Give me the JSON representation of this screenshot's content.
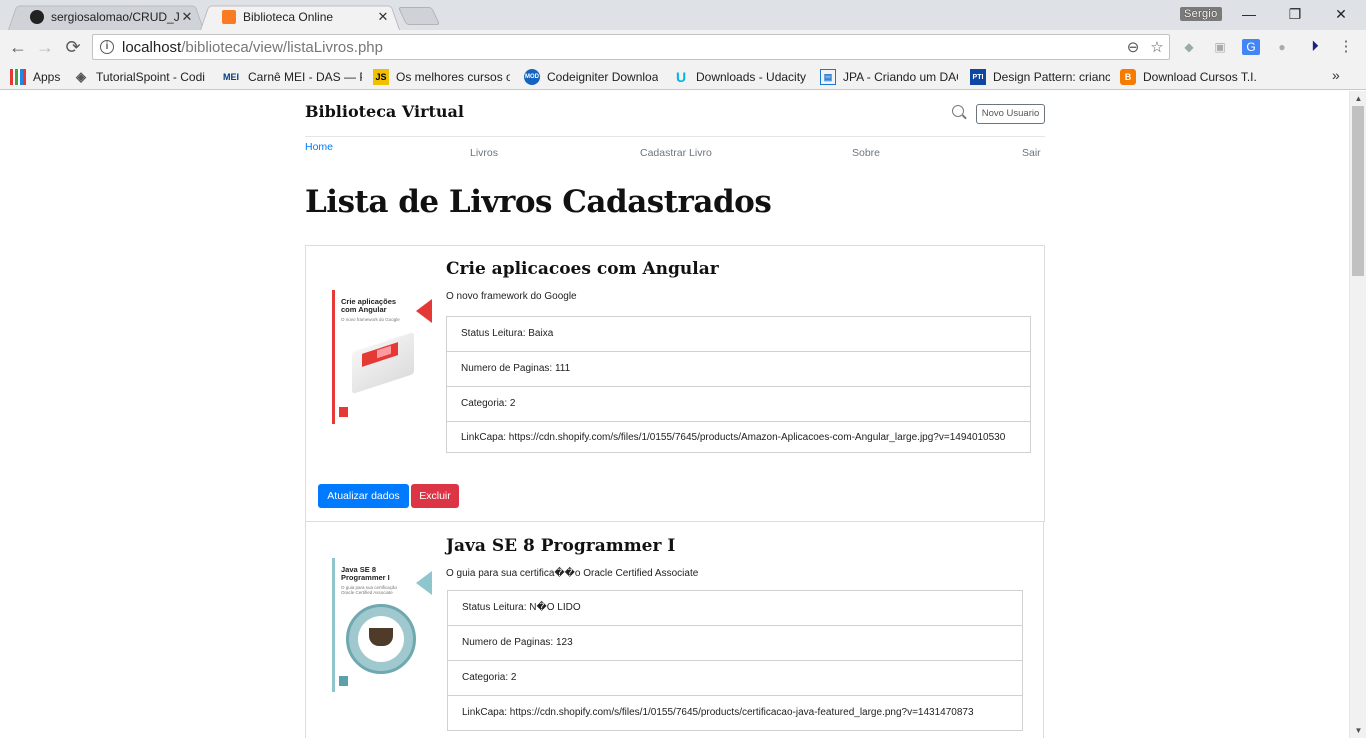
{
  "browser": {
    "tabs": [
      {
        "title": "sergiosalomao/CRUD_JSP",
        "active": false
      },
      {
        "title": "Biblioteca Online",
        "active": true
      }
    ],
    "profile_name": "Sergio",
    "address": {
      "host": "localhost",
      "path": "/biblioteca/view/listaLivros.php"
    },
    "bookmarks": [
      {
        "label": "Apps",
        "icon": "apps-grid-icon",
        "color": "#e44"
      },
      {
        "label": "TutorialSpoint - Codi",
        "icon": "tutorialspoint-icon",
        "color": "#555"
      },
      {
        "label": "Carnê MEI - DAS — P",
        "icon": "mei-icon",
        "color": "#0a3c7a"
      },
      {
        "label": "Os melhores cursos o",
        "icon": "js-icon",
        "color": "#f0c000"
      },
      {
        "label": "Codeigniter Downloa",
        "icon": "codeigniter-icon",
        "color": "#1565c0"
      },
      {
        "label": "Downloads - Udacity",
        "icon": "udacity-icon",
        "color": "#02b3e4"
      },
      {
        "label": "JPA - Criando um DAO",
        "icon": "page-icon",
        "color": "#1976d2"
      },
      {
        "label": "Design Pattern: crianc",
        "icon": "pti-icon",
        "color": "#0d47a1"
      },
      {
        "label": "Download Cursos T.I.",
        "icon": "blogger-icon",
        "color": "#f57c00"
      }
    ],
    "more_bookmarks": "»"
  },
  "site": {
    "brand": "Biblioteca Virtual",
    "new_user_label": "Novo Usuario",
    "nav": {
      "home": "Home",
      "books": "Livros",
      "register": "Cadastrar Livro",
      "about": "Sobre",
      "logout": "Sair"
    },
    "heading": "Lista de Livros Cadastrados"
  },
  "books": [
    {
      "title": "Crie aplicacoes com Angular",
      "subtitle": "O novo framework do Google",
      "status": "Status Leitura: Baixa",
      "pages": "Numero de Paginas: 111",
      "category": "Categoria: 2",
      "cover_link": "LinkCapa: https://cdn.shopify.com/s/files/1/0155/7645/products/Amazon-Aplicacoes-com-Angular_large.jpg?v=1494010530",
      "cover": {
        "title": "Crie aplicações com Angular",
        "subtitle": "O novo framework do Google",
        "accent": "#e53935"
      }
    },
    {
      "title": "Java SE 8 Programmer I",
      "subtitle": "O guia para sua certifica��o Oracle Certified Associate",
      "status": "Status Leitura: N�O LIDO",
      "pages": "Numero de Paginas: 123",
      "category": "Categoria: 2",
      "cover_link": "LinkCapa: https://cdn.shopify.com/s/files/1/0155/7645/products/certificacao-java-featured_large.png?v=1431470873",
      "cover": {
        "title": "Java SE 8 Programmer I",
        "subtitle": "O guia para sua certificação Oracle Certified Associate",
        "accent": "#8fc5cc"
      }
    }
  ],
  "actions": {
    "update": "Atualizar dados",
    "delete": "Excluir"
  }
}
